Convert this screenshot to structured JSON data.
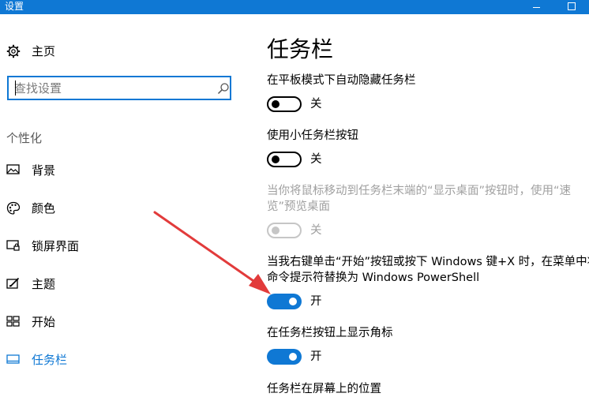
{
  "window": {
    "title": "设置"
  },
  "sidebar": {
    "home_label": "主页",
    "search_placeholder": "查找设置",
    "section_title": "个性化",
    "items": [
      {
        "label": "背景",
        "icon": "picture-icon"
      },
      {
        "label": "颜色",
        "icon": "palette-icon"
      },
      {
        "label": "锁屏界面",
        "icon": "lock-screen-icon"
      },
      {
        "label": "主题",
        "icon": "theme-icon"
      },
      {
        "label": "开始",
        "icon": "start-icon"
      },
      {
        "label": "任务栏",
        "icon": "taskbar-icon",
        "selected": true
      }
    ]
  },
  "main": {
    "title": "任务栏",
    "settings": [
      {
        "label": "在平板模式下自动隐藏任务栏",
        "state": "关",
        "on": false,
        "enabled": true
      },
      {
        "label": "使用小任务栏按钮",
        "state": "关",
        "on": false,
        "enabled": true
      },
      {
        "label_line1": "当你将鼠标移动到任务栏末端的“显示桌面”按钮时，使用“速",
        "label_line2": "览”预览桌面",
        "state": "关",
        "on": false,
        "enabled": false
      },
      {
        "label_line1": "当我右键单击“开始”按钮或按下 Windows 键+X 时，在菜单中将",
        "label_line2": "命令提示符替换为 Windows PowerShell",
        "state": "开",
        "on": true,
        "enabled": true
      },
      {
        "label": "在任务栏按钮上显示角标",
        "state": "开",
        "on": true,
        "enabled": true
      },
      {
        "label": "任务栏在屏幕上的位置"
      }
    ]
  },
  "colors": {
    "accent": "#0f78d4",
    "annotation_arrow": "#e23b3b"
  }
}
